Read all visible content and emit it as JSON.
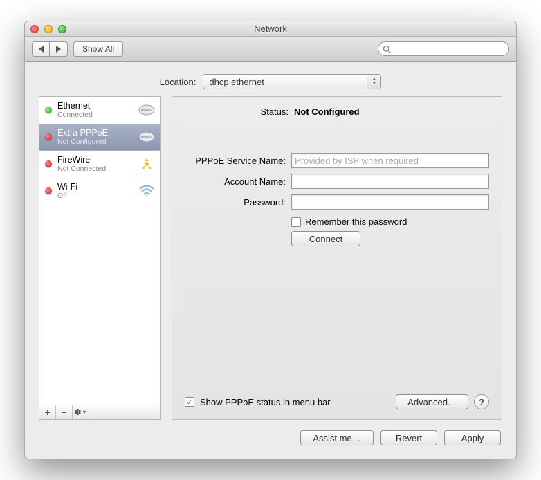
{
  "window": {
    "title": "Network"
  },
  "toolbar": {
    "show_all": "Show All",
    "search_placeholder": ""
  },
  "location": {
    "label": "Location:",
    "value": "dhcp ethernet"
  },
  "sidebar": {
    "items": [
      {
        "name": "Ethernet",
        "status": "Connected",
        "dot": "green"
      },
      {
        "name": "Extra PPPoE",
        "status": "Not Configured",
        "dot": "red"
      },
      {
        "name": "FireWire",
        "status": "Not Connected",
        "dot": "red"
      },
      {
        "name": "Wi-Fi",
        "status": "Off",
        "dot": "red"
      }
    ]
  },
  "panel": {
    "status_label": "Status:",
    "status_value": "Not Configured",
    "service_label": "PPPoE Service Name:",
    "service_placeholder": "Provided by ISP when required",
    "account_label": "Account Name:",
    "password_label": "Password:",
    "remember_label": "Remember this password",
    "connect_label": "Connect",
    "show_status_label": "Show PPPoE status in menu bar",
    "advanced_label": "Advanced…"
  },
  "footer": {
    "assist": "Assist me…",
    "revert": "Revert",
    "apply": "Apply"
  }
}
